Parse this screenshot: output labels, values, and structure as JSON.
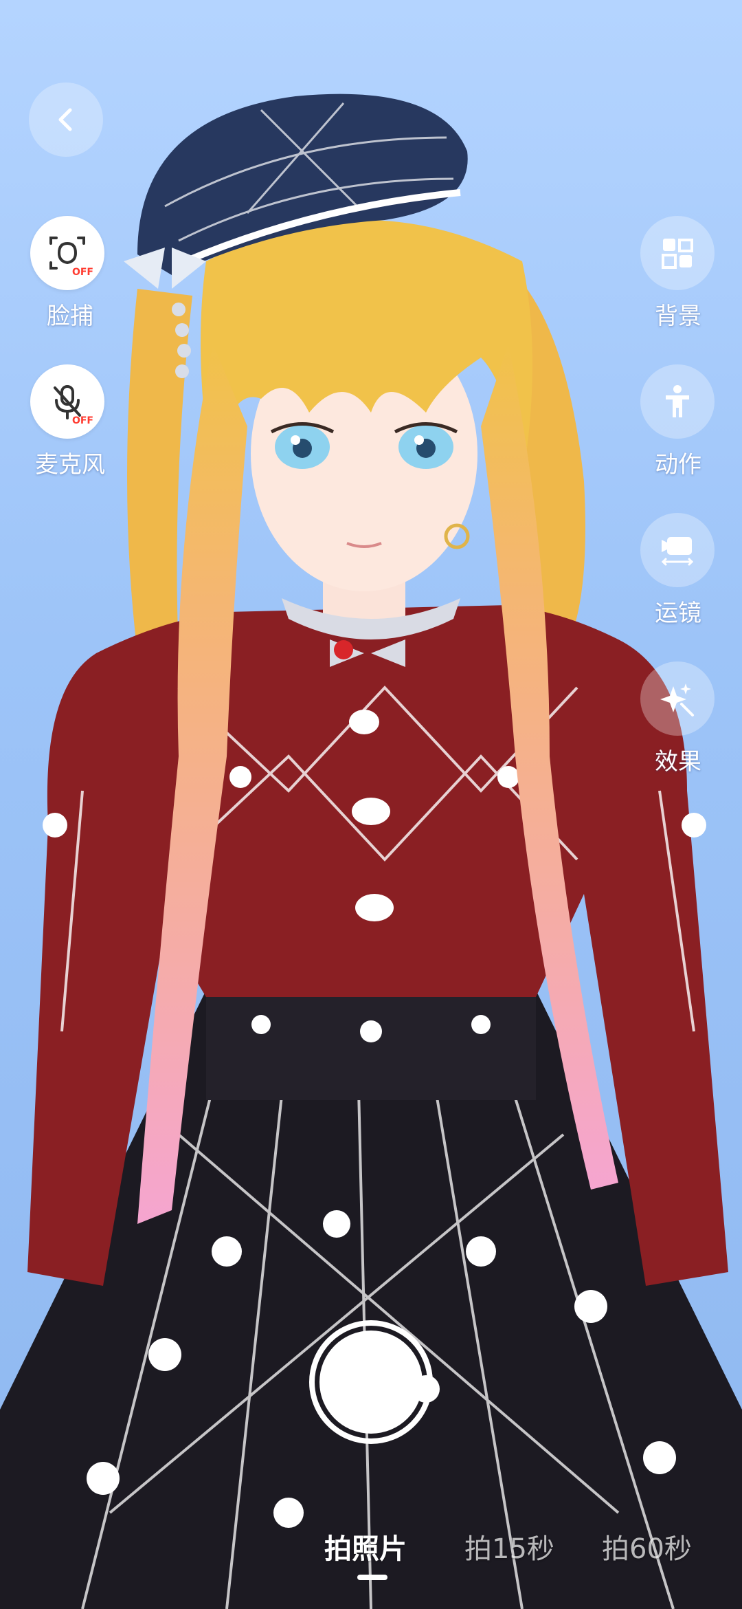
{
  "left_controls": [
    {
      "label": "脸捕",
      "icon": "face-capture-icon",
      "status": "OFF"
    },
    {
      "label": "麦克风",
      "icon": "microphone-muted-icon",
      "status": "OFF"
    }
  ],
  "right_controls": [
    {
      "label": "背景",
      "icon": "background-icon"
    },
    {
      "label": "动作",
      "icon": "action-figure-icon"
    },
    {
      "label": "运镜",
      "icon": "camera-movement-icon"
    },
    {
      "label": "效果",
      "icon": "effects-sparkle-icon"
    }
  ],
  "modes": [
    {
      "label": "拍照片",
      "active": true
    },
    {
      "label": "拍15秒",
      "active": false
    },
    {
      "label": "拍60秒",
      "active": false
    }
  ],
  "colors": {
    "background": "#9dc4f8",
    "hair_blonde": "#f1c24a",
    "hair_pink": "#f5a5d0",
    "hat_navy": "#27385f",
    "blouse_red": "#8a1f23",
    "skirt_black": "#1c1a22",
    "off_badge": "#ff3b30"
  }
}
